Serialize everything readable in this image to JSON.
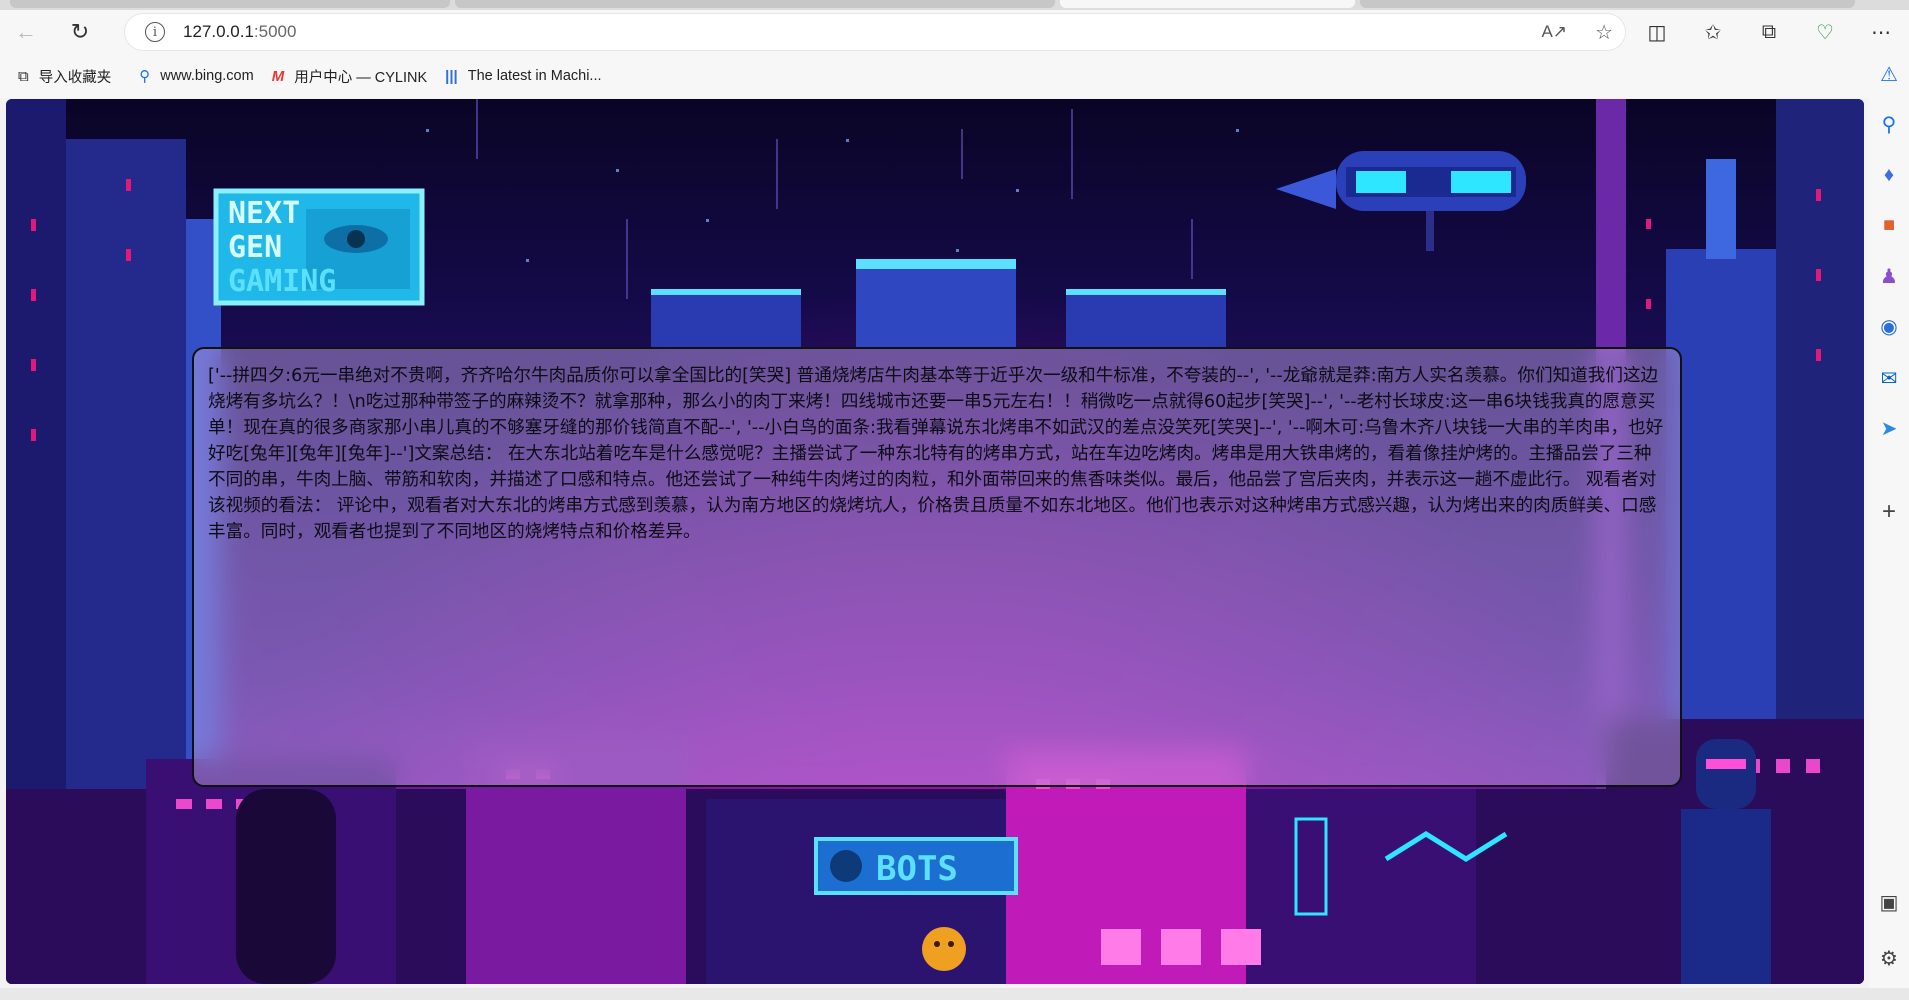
{
  "browser": {
    "url_host": "127.0.0.1",
    "url_port": ":5000",
    "bookmarks": [
      {
        "label": "导入收藏夹",
        "icon": "import-favorites-icon"
      },
      {
        "label": "www.bing.com",
        "icon": "bing-search-icon"
      },
      {
        "label": "用户中心 — CYLINK",
        "icon": "cylink-logo-icon"
      },
      {
        "label": "The latest in Machi...",
        "icon": "paperswithcode-icon"
      }
    ]
  },
  "page": {
    "logo_lines": [
      "NEXT",
      "GEN",
      "GAMING"
    ],
    "sign_bots": "BOTS",
    "result_text": "['--拼四夕:6元一串绝对不贵啊，齐齐哈尔牛肉品质你可以拿全国比的[笑哭] 普通烧烤店牛肉基本等于近乎次一级和牛标准，不夸装的--', '--龙爺就是莽:南方人实名羡慕。你们知道我们这边烧烤有多坑么？！\\n吃过那种带签子的麻辣烫不？就拿那种，那么小的肉丁来烤！四线城市还要一串5元左右！！稍微吃一点就得60起步[笑哭]--', '--老村长球皮:这一串6块钱我真的愿意买单！现在真的很多商家那小串儿真的不够塞牙缝的那价钱简直不配--', '--小白鸟的面条:我看弹幕说东北烤串不如武汉的差点没笑死[笑哭]--', '--啊木可:乌鲁木齐八块钱一大串的羊肉串，也好好吃[兔年][兔年][兔年]--']文案总结： 在大东北站着吃车是什么感觉呢？主播尝试了一种东北特有的烤串方式，站在车边吃烤肉。烤串是用大铁串烤的，看着像挂炉烤的。主播品尝了三种不同的串，牛肉上脑、带筋和软肉，并描述了口感和特点。他还尝试了一种纯牛肉烤过的肉粒，和外面带回来的焦香味类似。最后，他品尝了宫后夹肉，并表示这一趟不虚此行。 观看者对该视频的看法： 评论中，观看者对大东北的烤串方式感到羡慕，认为南方地区的烧烤坑人，价格贵且质量不如东北地区。他们也表示对这种烤串方式感兴趣，认为烤出来的肉质鲜美、口感丰富。同时，观看者也提到了不同地区的烧烤特点和价格差异。"
  },
  "colors": {
    "sky_top": "#0a0526",
    "sky_mid": "#241066",
    "neon_pink": "#e600c8",
    "neon_cyan": "#2ee6ff",
    "panel_border": "#111111"
  }
}
